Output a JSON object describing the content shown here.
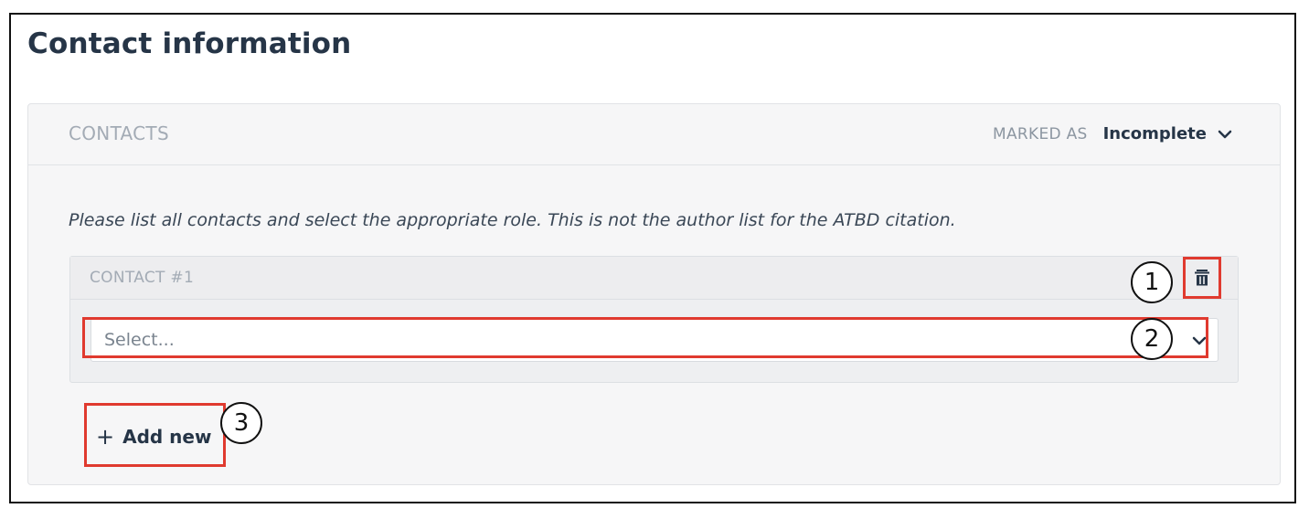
{
  "page": {
    "title": "Contact information"
  },
  "contacts_panel": {
    "title": "CONTACTS",
    "status_label": "MARKED AS",
    "status_value": "Incomplete",
    "status_icon": "chevron-down-icon",
    "instructions": "Please list all contacts and select the appropriate role. This is not the author list for the ATBD citation."
  },
  "contact_card": {
    "title": "CONTACT #1",
    "delete_icon": "trash-icon",
    "select_placeholder": "Select...",
    "select_icon": "chevron-down-icon"
  },
  "add_new": {
    "icon": "plus-icon",
    "label": "Add new"
  },
  "callouts": [
    "1",
    "2",
    "3"
  ],
  "colors": {
    "highlight": "#e03a2f",
    "heading": "#263547",
    "muted_label": "#a3abb5",
    "panel_bg": "#f6f6f7"
  }
}
